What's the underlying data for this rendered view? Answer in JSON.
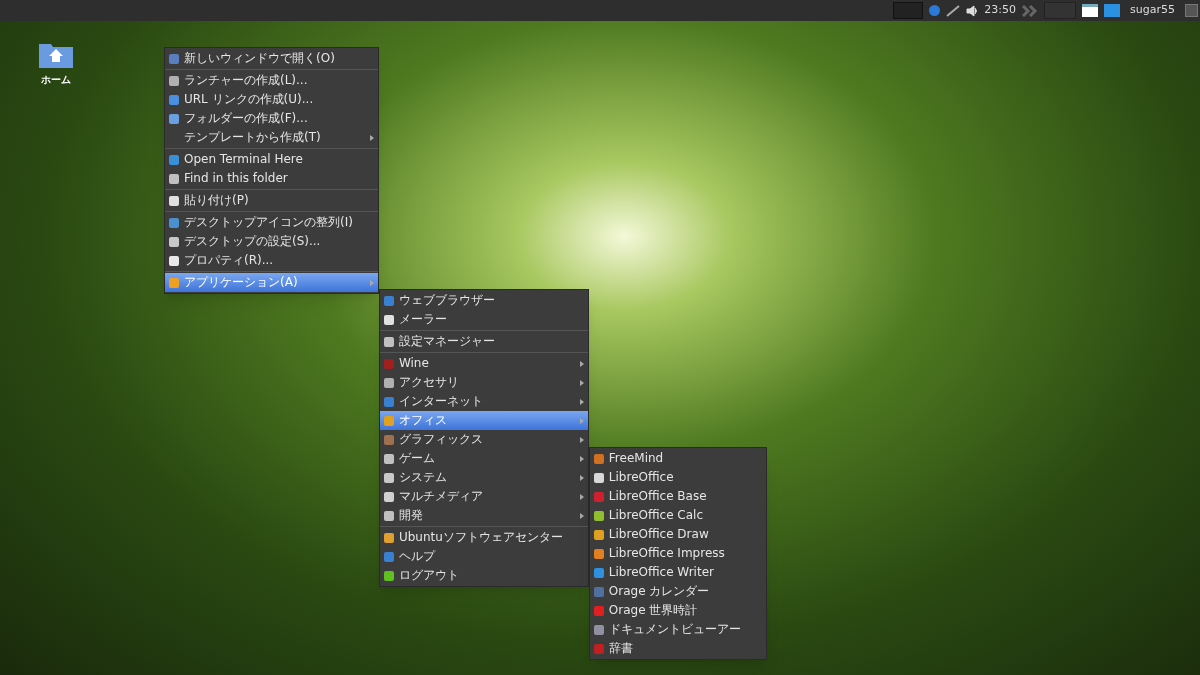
{
  "panel": {
    "clock": "23:50",
    "user": "sugar55"
  },
  "desktop_icons": [
    {
      "label": "ホーム"
    }
  ],
  "context_menu": {
    "items": [
      {
        "kind": "item",
        "label": "新しいウィンドウで開く(O)",
        "color": "#5a7fc0",
        "has_submenu": false,
        "selected": false
      },
      {
        "kind": "separator"
      },
      {
        "kind": "item",
        "label": "ランチャーの作成(L)...",
        "color": "#b0b0b0",
        "has_submenu": false,
        "selected": false
      },
      {
        "kind": "item",
        "label": "URL リンクの作成(U)...",
        "color": "#4a8fe0",
        "has_submenu": false,
        "selected": false
      },
      {
        "kind": "item",
        "label": "フォルダーの作成(F)...",
        "color": "#6aa0e0",
        "has_submenu": false,
        "selected": false
      },
      {
        "kind": "item",
        "label": "テンプレートから作成(T)",
        "has_submenu": true,
        "selected": false
      },
      {
        "kind": "separator"
      },
      {
        "kind": "item",
        "label": "Open Terminal Here",
        "color": "#3a90d8",
        "has_submenu": false,
        "selected": false
      },
      {
        "kind": "item",
        "label": "Find in this folder",
        "color": "#c0c0c0",
        "has_submenu": false,
        "selected": false
      },
      {
        "kind": "separator"
      },
      {
        "kind": "item",
        "label": "貼り付け(P)",
        "color": "#e0e0e0",
        "has_submenu": false,
        "selected": false
      },
      {
        "kind": "separator"
      },
      {
        "kind": "item",
        "label": "デスクトップアイコンの整列(I)",
        "color": "#4a90d0",
        "has_submenu": false,
        "selected": false
      },
      {
        "kind": "item",
        "label": "デスクトップの設定(S)...",
        "color": "#c8c8c8",
        "has_submenu": false,
        "selected": false
      },
      {
        "kind": "item",
        "label": "プロパティ(R)...",
        "color": "#e8e8e8",
        "has_submenu": false,
        "selected": false
      },
      {
        "kind": "separator"
      },
      {
        "kind": "item",
        "label": "アプリケーション(A)",
        "color": "#f0a020",
        "has_submenu": true,
        "selected": true
      }
    ]
  },
  "applications_menu": {
    "items": [
      {
        "kind": "item",
        "label": "ウェブブラウザー",
        "color": "#3a80d0",
        "has_submenu": false,
        "selected": false
      },
      {
        "kind": "item",
        "label": "メーラー",
        "color": "#e0e0e0",
        "has_submenu": false,
        "selected": false
      },
      {
        "kind": "separator"
      },
      {
        "kind": "item",
        "label": "設定マネージャー",
        "color": "#c0c0c0",
        "has_submenu": false,
        "selected": false
      },
      {
        "kind": "separator"
      },
      {
        "kind": "item",
        "label": "Wine",
        "color": "#a02020",
        "has_submenu": true,
        "selected": false
      },
      {
        "kind": "item",
        "label": "アクセサリ",
        "color": "#b0b0b0",
        "has_submenu": true,
        "selected": false
      },
      {
        "kind": "item",
        "label": "インターネット",
        "color": "#3a80d0",
        "has_submenu": true,
        "selected": false
      },
      {
        "kind": "item",
        "label": "オフィス",
        "color": "#e0a020",
        "has_submenu": true,
        "selected": true
      },
      {
        "kind": "item",
        "label": "グラフィックス",
        "color": "#a07050",
        "has_submenu": true,
        "selected": false
      },
      {
        "kind": "item",
        "label": "ゲーム",
        "color": "#c0c0c0",
        "has_submenu": true,
        "selected": false
      },
      {
        "kind": "item",
        "label": "システム",
        "color": "#c8c8c8",
        "has_submenu": true,
        "selected": false
      },
      {
        "kind": "item",
        "label": "マルチメディア",
        "color": "#d0d0d0",
        "has_submenu": true,
        "selected": false
      },
      {
        "kind": "item",
        "label": "開発",
        "color": "#c0c0c0",
        "has_submenu": true,
        "selected": false
      },
      {
        "kind": "separator"
      },
      {
        "kind": "item",
        "label": "Ubuntuソフトウェアセンター",
        "color": "#e0a030",
        "has_submenu": false,
        "selected": false
      },
      {
        "kind": "item",
        "label": "ヘルプ",
        "color": "#3a80d0",
        "has_submenu": false,
        "selected": false
      },
      {
        "kind": "item",
        "label": "ログアウト",
        "color": "#60c020",
        "has_submenu": false,
        "selected": false
      }
    ]
  },
  "office_menu": {
    "items": [
      {
        "kind": "item",
        "label": "FreeMind",
        "color": "#d07020",
        "has_submenu": false,
        "selected": false
      },
      {
        "kind": "item",
        "label": "LibreOffice",
        "color": "#d8d8d8",
        "has_submenu": false,
        "selected": false
      },
      {
        "kind": "item",
        "label": "LibreOffice Base",
        "color": "#d02030",
        "has_submenu": false,
        "selected": false
      },
      {
        "kind": "item",
        "label": "LibreOffice Calc",
        "color": "#90c030",
        "has_submenu": false,
        "selected": false
      },
      {
        "kind": "item",
        "label": "LibreOffice Draw",
        "color": "#e0a020",
        "has_submenu": false,
        "selected": false
      },
      {
        "kind": "item",
        "label": "LibreOffice Impress",
        "color": "#e08020",
        "has_submenu": false,
        "selected": false
      },
      {
        "kind": "item",
        "label": "LibreOffice Writer",
        "color": "#3090e0",
        "has_submenu": false,
        "selected": false
      },
      {
        "kind": "item",
        "label": "Orage カレンダー",
        "color": "#5070a0",
        "has_submenu": false,
        "selected": false
      },
      {
        "kind": "item",
        "label": "Orage 世界時計",
        "color": "#e02020",
        "has_submenu": false,
        "selected": false
      },
      {
        "kind": "item",
        "label": "ドキュメントビューアー",
        "color": "#9090a0",
        "has_submenu": false,
        "selected": false
      },
      {
        "kind": "item",
        "label": "辞書",
        "color": "#c02020",
        "has_submenu": false,
        "selected": false
      }
    ]
  }
}
